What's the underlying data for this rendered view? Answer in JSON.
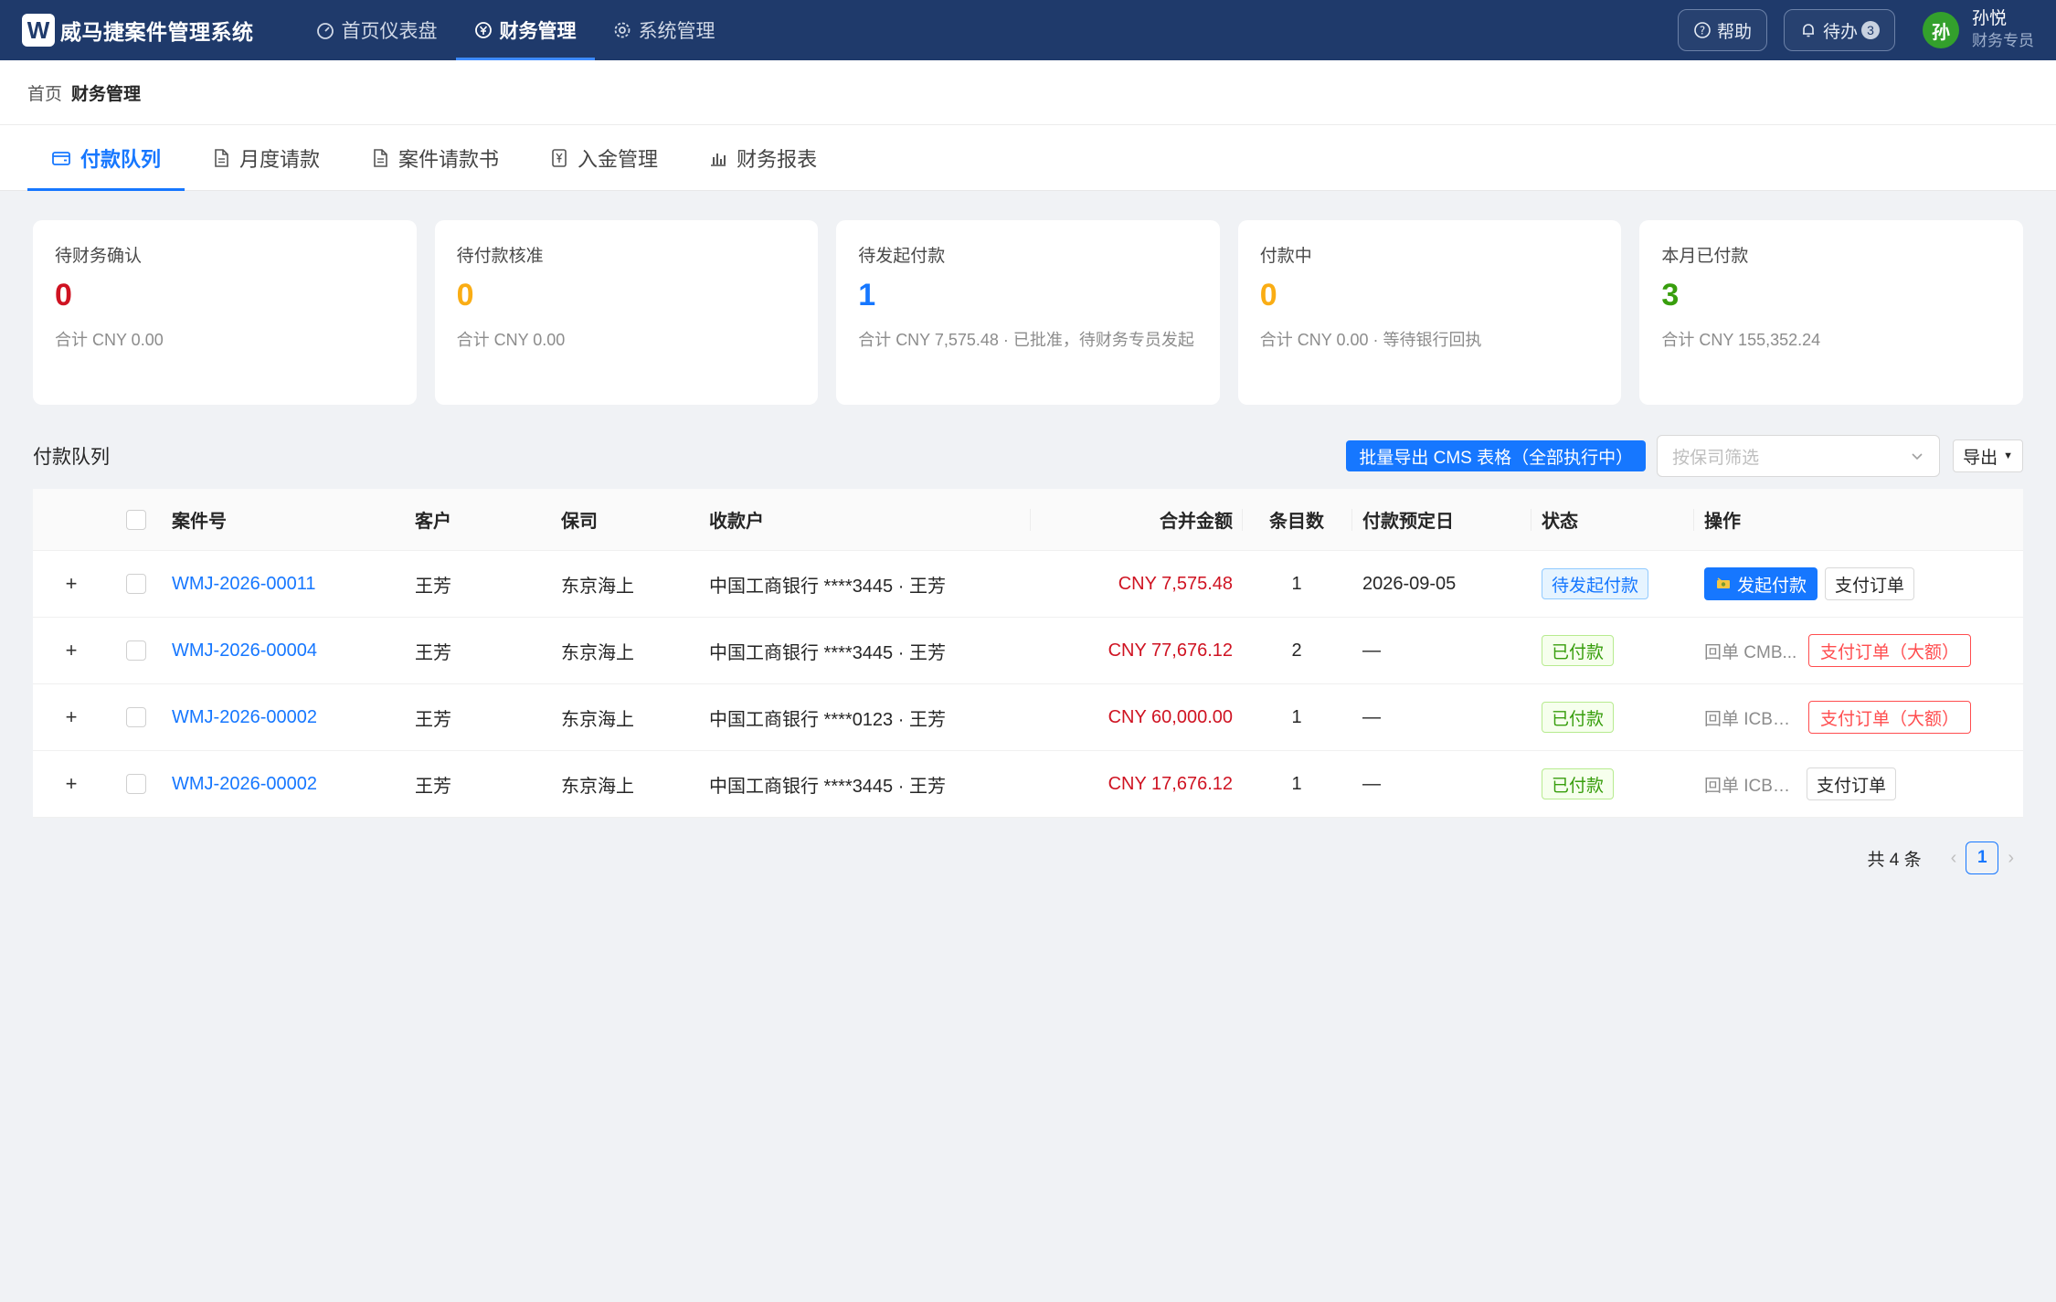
{
  "app": {
    "logo_letter": "W",
    "title": "威马捷案件管理系统"
  },
  "topnav": [
    {
      "label": "首页仪表盘",
      "icon": "dashboard-icon"
    },
    {
      "label": "财务管理",
      "icon": "finance-icon",
      "active": true
    },
    {
      "label": "系统管理",
      "icon": "gear-icon"
    }
  ],
  "header": {
    "help_label": "帮助",
    "todo_label": "待办",
    "todo_count": "3",
    "user_initial": "孙",
    "user_name": "孙悦",
    "user_role": "财务专员"
  },
  "breadcrumb": {
    "home": "首页",
    "current": "财务管理"
  },
  "tabs": [
    {
      "label": "付款队列",
      "icon": "wallet-icon",
      "active": true
    },
    {
      "label": "月度请款",
      "icon": "document-icon"
    },
    {
      "label": "案件请款书",
      "icon": "document-icon"
    },
    {
      "label": "入金管理",
      "icon": "yen-icon"
    },
    {
      "label": "财务报表",
      "icon": "bar-chart-icon"
    }
  ],
  "stats": [
    {
      "label": "待财务确认",
      "value": "0",
      "sub": "合计 CNY 0.00",
      "color": "#cf1322"
    },
    {
      "label": "待付款核准",
      "value": "0",
      "sub": "合计 CNY 0.00",
      "color": "#faad14"
    },
    {
      "label": "待发起付款",
      "value": "1",
      "sub": "合计 CNY 7,575.48 · 已批准，待财务专员发起",
      "color": "#1677ff"
    },
    {
      "label": "付款中",
      "value": "0",
      "sub": "合计 CNY 0.00 · 等待银行回执",
      "color": "#faad14"
    },
    {
      "label": "本月已付款",
      "value": "3",
      "sub": "合计 CNY 155,352.24",
      "color": "#389e0d"
    }
  ],
  "queue": {
    "title": "付款队列",
    "batch_export_label": "批量导出 CMS 表格（全部执行中）",
    "filter_placeholder": "按保司筛选",
    "export_label": "导出"
  },
  "table": {
    "columns": {
      "case": "案件号",
      "customer": "客户",
      "insurer": "保司",
      "payee": "收款户",
      "amount": "合并金额",
      "count": "条目数",
      "date": "付款预定日",
      "status": "状态",
      "ops": "操作"
    },
    "rows": [
      {
        "case": "WMJ-2026-00011",
        "customer": "王芳",
        "insurer": "东京海上",
        "payee": "中国工商银行 ****3445 · 王芳",
        "amount": "CNY 7,575.48",
        "count": "1",
        "date": "2026-09-05",
        "status": "待发起付款",
        "status_color": "blue",
        "receipt": "",
        "primary_op": "发起付款",
        "op": "支付订单",
        "op_style": "default"
      },
      {
        "case": "WMJ-2026-00004",
        "customer": "王芳",
        "insurer": "东京海上",
        "payee": "中国工商银行 ****3445 · 王芳",
        "amount": "CNY 77,676.12",
        "count": "2",
        "date": "—",
        "status": "已付款",
        "status_color": "green",
        "receipt": "回单 CMB...",
        "primary_op": "",
        "op": "支付订单（大额）",
        "op_style": "danger"
      },
      {
        "case": "WMJ-2026-00002",
        "customer": "王芳",
        "insurer": "东京海上",
        "payee": "中国工商银行 ****0123 · 王芳",
        "amount": "CNY 60,000.00",
        "count": "1",
        "date": "—",
        "status": "已付款",
        "status_color": "green",
        "receipt": "回单 ICBC...",
        "primary_op": "",
        "op": "支付订单（大额）",
        "op_style": "danger"
      },
      {
        "case": "WMJ-2026-00002",
        "customer": "王芳",
        "insurer": "东京海上",
        "payee": "中国工商银行 ****3445 · 王芳",
        "amount": "CNY 17,676.12",
        "count": "1",
        "date": "—",
        "status": "已付款",
        "status_color": "green",
        "receipt": "回单 ICBC...",
        "primary_op": "",
        "op": "支付订单",
        "op_style": "default"
      }
    ]
  },
  "pagination": {
    "total_label": "共 4 条",
    "current_page": "1"
  }
}
